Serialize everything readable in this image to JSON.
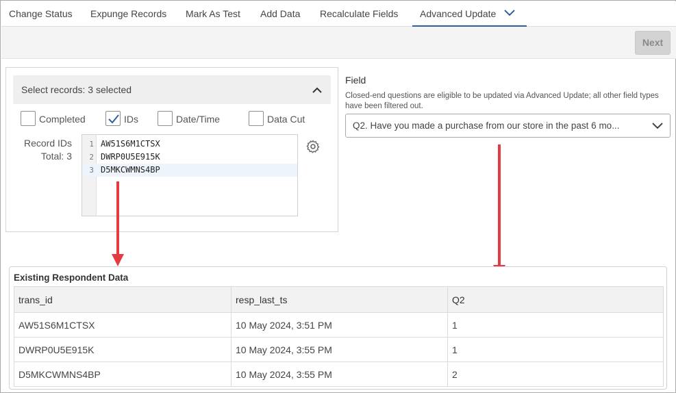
{
  "tabs": [
    {
      "label": "Change Status"
    },
    {
      "label": "Expunge Records"
    },
    {
      "label": "Mark As Test"
    },
    {
      "label": "Add Data"
    },
    {
      "label": "Recalculate Fields"
    },
    {
      "label": "Advanced Update",
      "active": true
    }
  ],
  "toolbar": {
    "next_label": "Next"
  },
  "select_records": {
    "header": "Select records: 3 selected",
    "options": [
      {
        "label": "Completed",
        "checked": false
      },
      {
        "label": "IDs",
        "checked": true
      },
      {
        "label": "Date/Time",
        "checked": false
      },
      {
        "label": "Data Cut",
        "checked": false
      }
    ],
    "record_ids_label": "Record IDs",
    "total_label": "Total: 3",
    "lines": [
      {
        "num": "1",
        "text": "AW51S6M1CTSX"
      },
      {
        "num": "2",
        "text": "DWRP0U5E915K"
      },
      {
        "num": "3",
        "text": "D5MKCWMNS4BP"
      }
    ]
  },
  "field": {
    "title": "Field",
    "description": "Closed-end questions are eligible to be updated via Advanced Update; all other field types have been filtered out.",
    "selected": "Q2. Have you made a purchase from our store in the past 6 mo..."
  },
  "existing": {
    "title": "Existing Respondent Data",
    "columns": [
      "trans_id",
      "resp_last_ts",
      "Q2"
    ],
    "rows": [
      [
        "AW51S6M1CTSX",
        "10 May 2024, 3:51 PM",
        "1"
      ],
      [
        "DWRP0U5E915K",
        "10 May 2024, 3:55 PM",
        "1"
      ],
      [
        "D5MKCWMNS4BP",
        "10 May 2024, 3:55 PM",
        "2"
      ]
    ]
  },
  "colors": {
    "accent": "#2b5f9e",
    "arrow": "#e53a40",
    "check": "#2b5f9e"
  }
}
